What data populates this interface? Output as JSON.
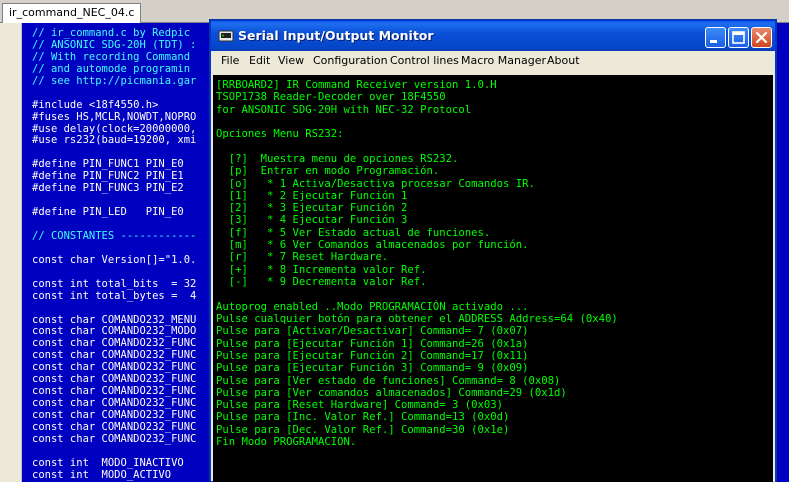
{
  "editor": {
    "tab_label": "ir_command_NEC_04.c",
    "lines": [
      {
        "text": "// ir_command.c by Redpic",
        "kind": "comment"
      },
      {
        "text": "// ANSONIC SDG-20H (TDT) :",
        "kind": "comment"
      },
      {
        "text": "// With recording Command",
        "kind": "comment"
      },
      {
        "text": "// and automode programin",
        "kind": "comment"
      },
      {
        "text": "// see http://picmania.gar",
        "kind": "comment"
      },
      {
        "text": "",
        "kind": "code"
      },
      {
        "text": "#include <18f4550.h>",
        "kind": "pre"
      },
      {
        "text": "#fuses HS,MCLR,NOWDT,NOPRO",
        "kind": "pre"
      },
      {
        "text": "#use delay(clock=20000000,",
        "kind": "pre"
      },
      {
        "text": "#use rs232(baud=19200, xmi",
        "kind": "pre"
      },
      {
        "text": "",
        "kind": "code"
      },
      {
        "text": "#define PIN_FUNC1 PIN_E0",
        "kind": "pre"
      },
      {
        "text": "#define PIN_FUNC2 PIN_E1",
        "kind": "pre"
      },
      {
        "text": "#define PIN_FUNC3 PIN_E2",
        "kind": "pre"
      },
      {
        "text": "",
        "kind": "code"
      },
      {
        "text": "#define PIN_LED   PIN_E0",
        "kind": "pre"
      },
      {
        "text": "",
        "kind": "code"
      },
      {
        "text": "// CONSTANTES ------------",
        "kind": "comment"
      },
      {
        "text": "",
        "kind": "code"
      },
      {
        "text": "const char Version[]=\"1.0.",
        "kind": "code"
      },
      {
        "text": "",
        "kind": "code"
      },
      {
        "text": "const int total_bits  = 32",
        "kind": "code"
      },
      {
        "text": "const int total_bytes =  4",
        "kind": "code"
      },
      {
        "text": "",
        "kind": "code"
      },
      {
        "text": "const char COMANDO232_MENU",
        "kind": "code"
      },
      {
        "text": "const char COMANDO232_MODO",
        "kind": "code"
      },
      {
        "text": "const char COMANDO232_FUNC",
        "kind": "code"
      },
      {
        "text": "const char COMANDO232_FUNC",
        "kind": "code"
      },
      {
        "text": "const char COMANDO232_FUNC",
        "kind": "code"
      },
      {
        "text": "const char COMANDO232_FUNC",
        "kind": "code"
      },
      {
        "text": "const char COMANDO232_FUNC",
        "kind": "code"
      },
      {
        "text": "const char COMANDO232_FUNC",
        "kind": "code"
      },
      {
        "text": "const char COMANDO232_FUNC",
        "kind": "code"
      },
      {
        "text": "const char COMANDO232_FUNC",
        "kind": "code"
      },
      {
        "text": "const char COMANDO232_FUNC",
        "kind": "code"
      },
      {
        "text": "",
        "kind": "code"
      },
      {
        "text": "const int  MODO_INACTIVO",
        "kind": "code"
      },
      {
        "text": "const int  MODO_ACTIVO",
        "kind": "code"
      }
    ]
  },
  "window": {
    "title": "Serial Input/Output Monitor",
    "menu": [
      "File",
      "Edit",
      "View",
      "Configuration",
      "Control lines",
      "Macro Manager",
      "About"
    ],
    "buttons": {
      "minimize": "minimize-icon",
      "maximize": "maximize-icon",
      "close": "close-icon"
    }
  },
  "terminal": {
    "lines": [
      "[RRBOARD2] IR Command Receiver version 1.0.H",
      "TSOP1738 Reader-Decoder over 18F4550",
      "for ANSONIC SDG-20H with NEC-32 Protocol",
      "",
      "Opciones Menu RS232:",
      "",
      "  [?]  Muestra menu de opciones RS232.",
      "  [p]  Entrar en modo Programación.",
      "  [o]   * 1 Activa/Desactiva procesar Comandos IR.",
      "  [1]   * 2 Ejecutar Función 1",
      "  [2]   * 3 Ejecutar Función 2",
      "  [3]   * 4 Ejecutar Función 3",
      "  [f]   * 5 Ver Estado actual de funciones.",
      "  [m]   * 6 Ver Comandos almacenados por función.",
      "  [r]   * 7 Reset Hardware.",
      "  [+]   * 8 Incrementa valor Ref.",
      "  [-]   * 9 Decrementa valor Ref.",
      "",
      "Autoprog enabled ..Modo PROGRAMACIÓN activado ...",
      "Pulse cualquier botón para obtener el ADDRESS Address=64 (0x40)",
      "Pulse para [Activar/Desactivar] Command= 7 (0x07)",
      "Pulse para [Ejecutar Función 1] Command=26 (0x1a)",
      "Pulse para [Ejecutar Función 2] Command=17 (0x11)",
      "Pulse para [Ejecutar Función 3] Command= 9 (0x09)",
      "Pulse para [Ver estado de funciones] Command= 8 (0x08)",
      "Pulse para [Ver comandos almacenados] Command=29 (0x1d)",
      "Pulse para [Reset Hardware] Command= 3 (0x03)",
      "Pulse para [Inc. Valor Ref.] Command=13 (0x0d)",
      "Pulse para [Dec. Valor Ref.] Command=30 (0x1e)",
      "Fin Modo PROGRAMACION."
    ]
  },
  "colors": {
    "editor_bg": "#0000c0",
    "terminal_bg": "#000000",
    "terminal_fg": "#00ff00",
    "titlebar": "#0a50d8"
  }
}
